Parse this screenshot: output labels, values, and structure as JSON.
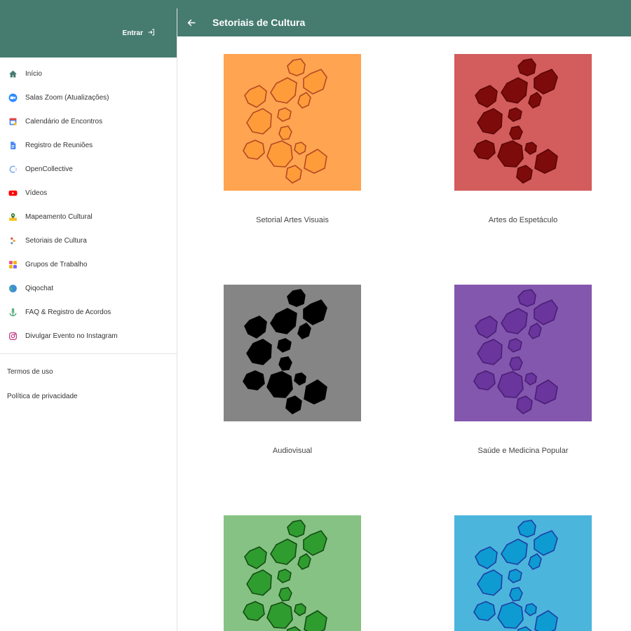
{
  "sidebar": {
    "login_label": "Entrar",
    "items": [
      {
        "label": "Início",
        "icon": "home-icon",
        "color": "#467b70"
      },
      {
        "label": "Salas Zoom (Atualizações)",
        "icon": "zoom-icon",
        "color": "#2d8cff"
      },
      {
        "label": "Calendário de Encontros",
        "icon": "calendar-icon",
        "color": "#4285f4"
      },
      {
        "label": "Registro de Reuniões",
        "icon": "document-icon",
        "color": "#4285f4"
      },
      {
        "label": "OpenCollective",
        "icon": "opencollective-icon",
        "color": "#7fadf2"
      },
      {
        "label": "Vídeos",
        "icon": "youtube-icon",
        "color": "#ff0000"
      },
      {
        "label": "Mapeamento Cultural",
        "icon": "map-icon",
        "color": "#2e7d32"
      },
      {
        "label": "Setoriais de Cultura",
        "icon": "puzzle-icon",
        "color": "#e8a23c"
      },
      {
        "label": "Grupos de Trabalho",
        "icon": "groups-icon",
        "color": "#f4b400"
      },
      {
        "label": "Qiqochat",
        "icon": "globe-icon",
        "color": "#3a8fd6"
      },
      {
        "label": "FAQ & Registro de Acordos",
        "icon": "anchor-icon",
        "color": "#2e9b5c"
      },
      {
        "label": "Divulgar Evento no Instagram",
        "icon": "instagram-icon",
        "color": "#c13584"
      }
    ],
    "links": [
      {
        "label": "Termos de uso"
      },
      {
        "label": "Política de privacidade"
      }
    ]
  },
  "header": {
    "title": "Setoriais de Cultura"
  },
  "cards": [
    {
      "label": "Setorial Artes Visuais",
      "bg": "#ffa450",
      "fill": "#ff9c3a",
      "stroke": "#b24a24"
    },
    {
      "label": "Artes do Espetáculo",
      "bg": "#d35c5c",
      "fill": "#7e0b0b",
      "stroke": "#5a0606"
    },
    {
      "label": "Audiovisual",
      "bg": "#858585",
      "fill": "#000000",
      "stroke": "#000000"
    },
    {
      "label": "Saúde e Medicina Popular",
      "bg": "#8457ae",
      "fill": "#6a359c",
      "stroke": "#4a1f76"
    },
    {
      "label": "",
      "bg": "#86c284",
      "fill": "#2f9c2f",
      "stroke": "#134d13"
    },
    {
      "label": "",
      "bg": "#4cb5dc",
      "fill": "#0e9bd1",
      "stroke": "#1c3fa6"
    }
  ]
}
